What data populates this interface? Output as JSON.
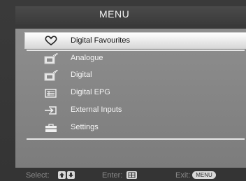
{
  "menu": {
    "title": "MENU",
    "items": [
      {
        "label": "Digital Favourites",
        "icon": "heart-icon",
        "selected": true
      },
      {
        "label": "Analogue",
        "icon": "analogue-tv-icon",
        "selected": false
      },
      {
        "label": "Digital",
        "icon": "digital-tv-icon",
        "selected": false
      },
      {
        "label": "Digital EPG",
        "icon": "epg-guide-icon",
        "selected": false
      },
      {
        "label": "External Inputs",
        "icon": "external-input-icon",
        "selected": false
      },
      {
        "label": "Settings",
        "icon": "settings-toolbox-icon",
        "selected": false
      }
    ]
  },
  "footer": {
    "select_label": "Select:",
    "enter_label": "Enter:",
    "exit_label": "Exit:",
    "menu_key_label": "MENU"
  }
}
